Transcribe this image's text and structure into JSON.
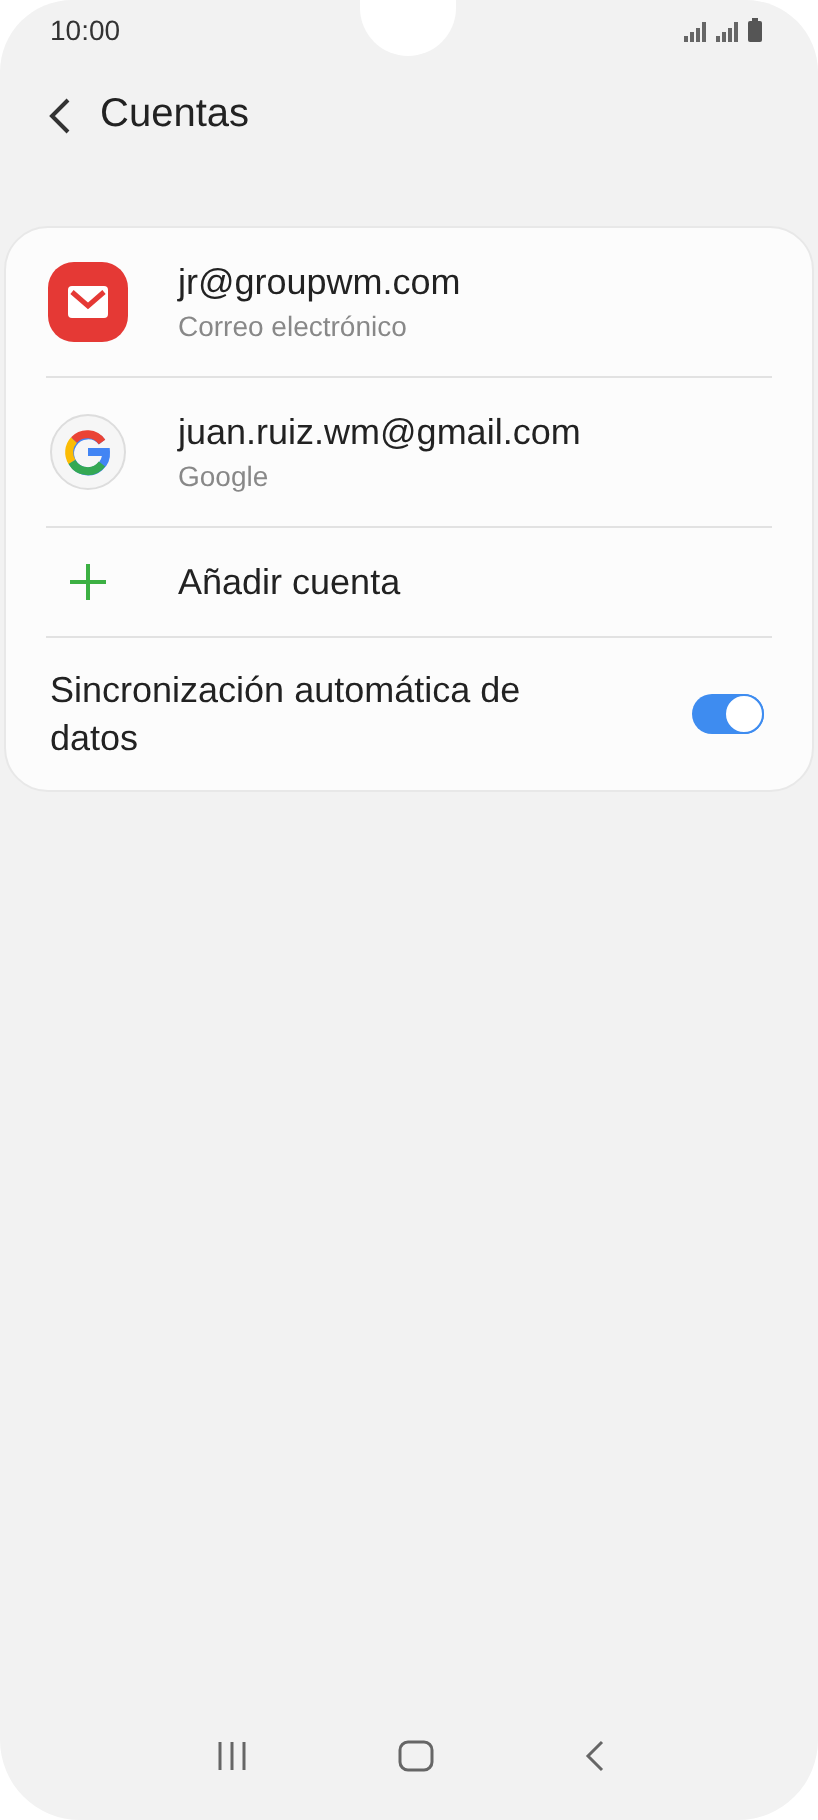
{
  "status_bar": {
    "time": "10:00"
  },
  "header": {
    "title": "Cuentas"
  },
  "accounts": [
    {
      "kind": "mail",
      "name": "jr@groupwm.com",
      "type": "Correo electrónico"
    },
    {
      "kind": "google",
      "name": "juan.ruiz.wm@gmail.com",
      "type": "Google"
    }
  ],
  "add_account": {
    "label": "Añadir cuenta"
  },
  "sync": {
    "label": "Sincronización automática de datos",
    "on": true
  }
}
